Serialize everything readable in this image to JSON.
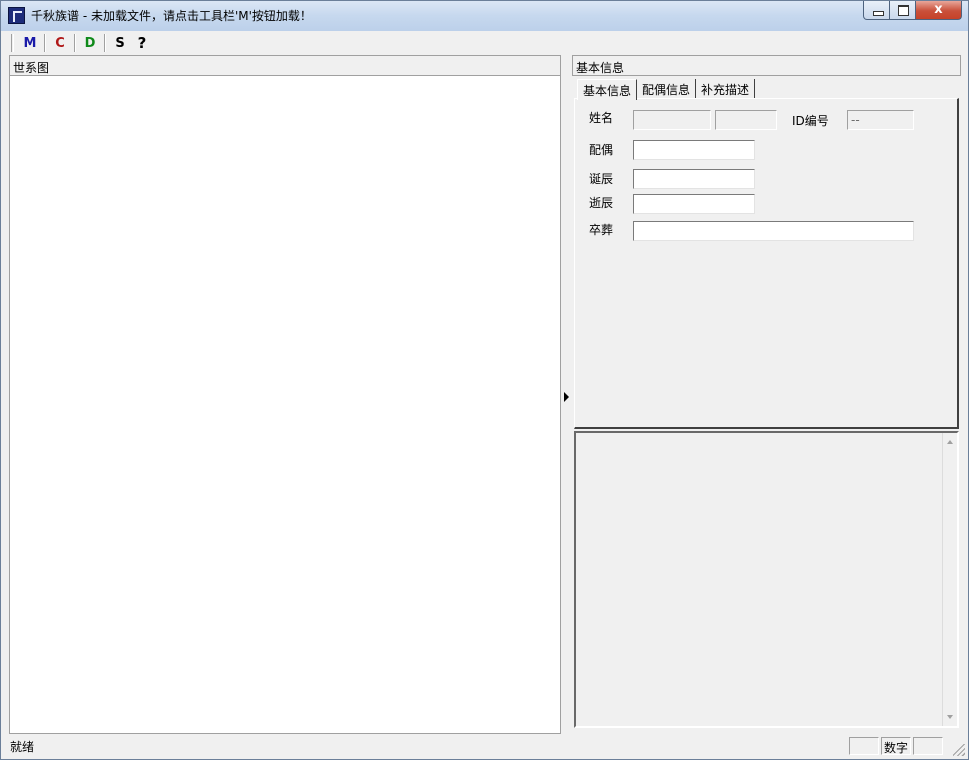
{
  "window": {
    "title": "千秋族谱 - 未加载文件，请点击工具栏'M'按钮加载！",
    "icon": "app-icon",
    "controls": {
      "minimize_icon": "minimize-icon",
      "maximize_icon": "maximize-icon",
      "close_glyph": "x"
    }
  },
  "toolbar": {
    "buttons": [
      {
        "label": "M",
        "color": "#1a1aa8"
      },
      {
        "label": "C",
        "color": "#b01818"
      },
      {
        "label": "D",
        "color": "#0f8a1a"
      },
      {
        "label": "S",
        "color": "#000000"
      },
      {
        "label": "?",
        "icon": "help-icon",
        "color": "#000000"
      }
    ]
  },
  "left_panel": {
    "title": "世系图"
  },
  "right_panel": {
    "title": "基本信息",
    "tabs": [
      {
        "label": "基本信息",
        "active": true
      },
      {
        "label": "配偶信息",
        "active": false
      },
      {
        "label": "补充描述",
        "active": false
      }
    ],
    "form": {
      "name_label": "姓名",
      "name_surname": "",
      "name_given": "",
      "id_label": "ID编号",
      "id_value": "--",
      "spouse_label": "配偶",
      "spouse_value": "",
      "birth_label": "诞辰",
      "birth_value": "",
      "death_label": "逝辰",
      "death_value": "",
      "burial_label": "卒葬",
      "burial_value": ""
    },
    "memo": {
      "value": ""
    }
  },
  "statusbar": {
    "message": "就绪",
    "pane1": "",
    "num_label": "数字",
    "pane3": ""
  }
}
